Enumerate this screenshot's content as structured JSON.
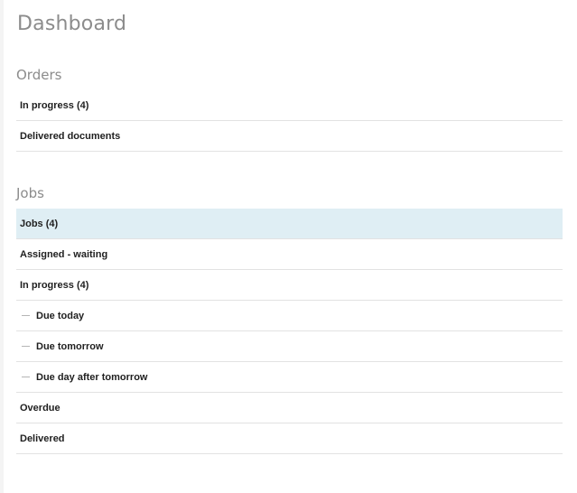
{
  "header": {
    "title": "Dashboard"
  },
  "orders": {
    "title": "Orders",
    "items": [
      {
        "label": "In progress (4)"
      },
      {
        "label": "Delivered documents"
      }
    ]
  },
  "jobs": {
    "title": "Jobs",
    "items": [
      {
        "label": "Jobs (4)",
        "active": true
      },
      {
        "label": "Assigned - waiting"
      },
      {
        "label": "In progress (4)"
      },
      {
        "label": "Due today",
        "sub": true
      },
      {
        "label": "Due tomorrow",
        "sub": true
      },
      {
        "label": "Due day after tomorrow",
        "sub": true
      },
      {
        "label": "Overdue"
      },
      {
        "label": "Delivered"
      }
    ]
  },
  "colors": {
    "active_row": "#dfeef4",
    "title_text": "#8c8c8c",
    "item_text": "#1f1f1f",
    "divider": "#e2e2e2"
  }
}
